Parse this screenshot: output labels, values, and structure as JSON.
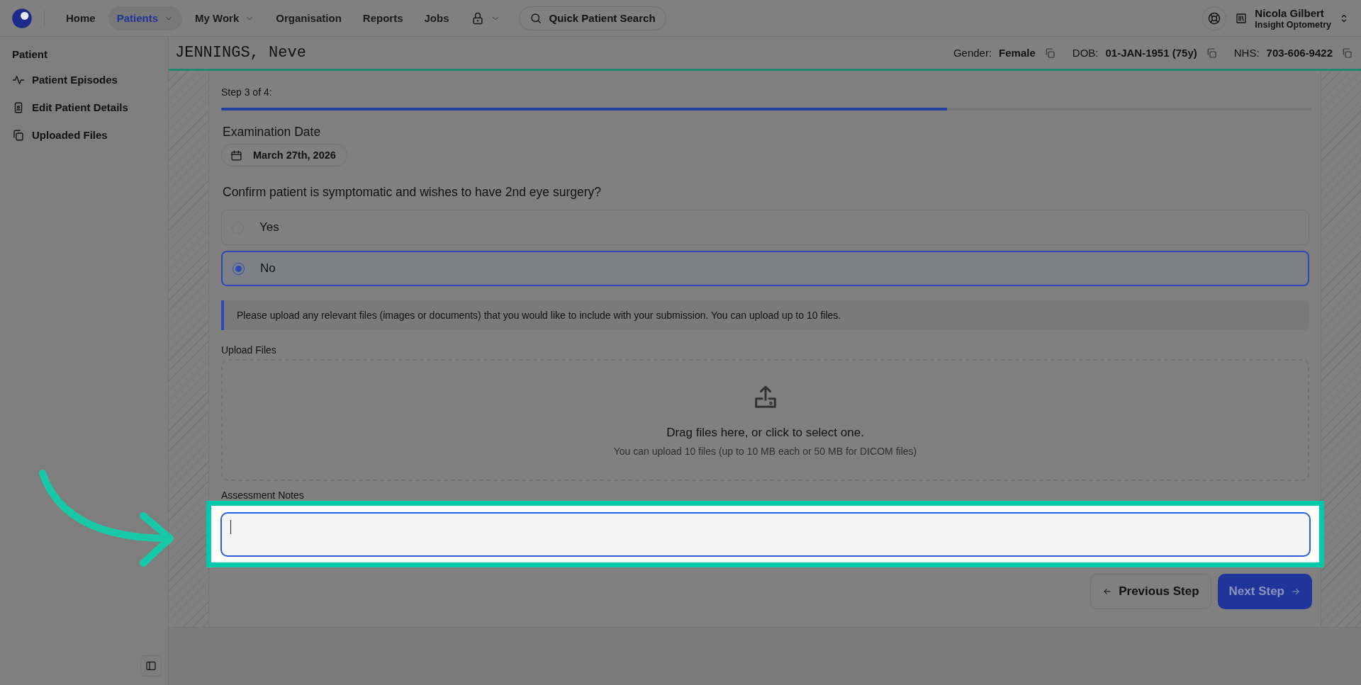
{
  "nav": {
    "items": [
      {
        "label": "Home",
        "kind": "link",
        "selected": false
      },
      {
        "label": "Patients",
        "kind": "menu",
        "selected": true
      },
      {
        "label": "My Work",
        "kind": "menu",
        "selected": false
      },
      {
        "label": "Organisation",
        "kind": "link",
        "selected": false
      },
      {
        "label": "Reports",
        "kind": "link",
        "selected": false
      },
      {
        "label": "Jobs",
        "kind": "link",
        "selected": false
      },
      {
        "kind": "lock",
        "selected": false
      }
    ],
    "search": "Quick Patient Search",
    "user": {
      "name": "Nicola Gilbert",
      "org": "Insight Optometry"
    }
  },
  "sidebar": {
    "heading": "Patient",
    "items": [
      {
        "label": "Patient Episodes",
        "kind": "pulse"
      },
      {
        "label": "Edit Patient Details",
        "kind": "card"
      },
      {
        "label": "Uploaded Files",
        "kind": "files"
      }
    ]
  },
  "patient": {
    "name": "JENNINGS, Neve",
    "fields": [
      {
        "label": "Gender:",
        "value": "Female"
      },
      {
        "label": "DOB:",
        "value": "01-JAN-1951 (75y)"
      },
      {
        "label": "NHS:",
        "value": "703-606-9422"
      }
    ]
  },
  "form": {
    "step": "Step 3 of 4:",
    "progress": {
      "level": 0.666
    },
    "date_label": "Examination Date",
    "date_value": "March 27th, 2026",
    "question": "Confirm patient is symptomatic and wishes to have 2nd eye surgery?",
    "options": [
      {
        "label": "Yes",
        "selected": false
      },
      {
        "label": "No",
        "selected": true
      }
    ],
    "info": "Please upload any relevant files (images or documents) that you would like to include with your submission. You can upload up to 10 files.",
    "upload_label": "Upload Files",
    "drop_title": "Drag files here, or click to select one.",
    "drop_hint": "You can upload 10 files (up to 10 MB each or 50 MB for DICOM files)",
    "notes_label": "Assessment Notes",
    "notes_highlighted": true,
    "buttons": [
      {
        "label": "Previous Step",
        "kind": "secondary"
      },
      {
        "label": "Next Step",
        "kind": "primary"
      }
    ]
  }
}
